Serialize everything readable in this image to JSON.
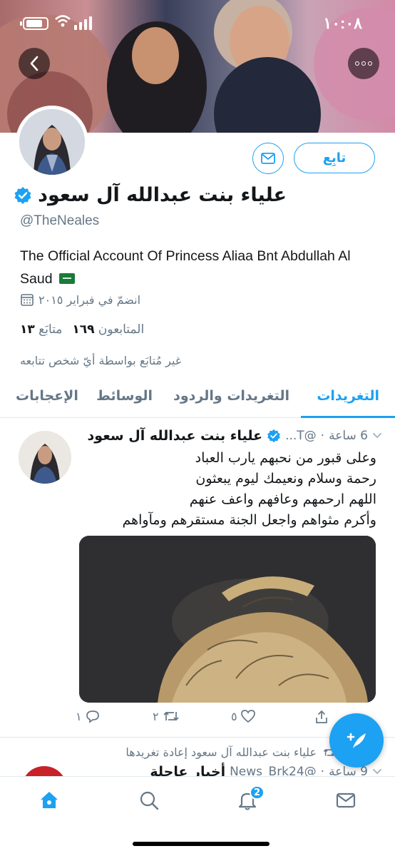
{
  "status_bar": {
    "time": "١٠:٠٨"
  },
  "profile": {
    "display_name": "علياء بنت عبدالله آل سعود",
    "handle": "@TheNeales",
    "bio": "The Official Account Of Princess Aliaa Bnt Abdullah Al Saud",
    "joined": "انضمّ في فبراير ٢٠١٥",
    "following_count": "١٣",
    "following_label": "متابَع",
    "followers_count": "١٦٩",
    "followers_label": "المتابعون",
    "not_followed_note": "غير مُتابَع بواسطة أيّ شخص تتابعه",
    "follow_label": "تابِع"
  },
  "tabs": [
    {
      "label": "التغريدات",
      "active": true
    },
    {
      "label": "التغريدات والردود",
      "active": false
    },
    {
      "label": "الوسائط",
      "active": false
    },
    {
      "label": "الإعجابات",
      "active": false
    }
  ],
  "tweet": {
    "author": "علياء بنت عبدالله آل سعود",
    "handle_trunc": "@T...",
    "time": "6 ساعة",
    "lines": [
      "وعلى قبور من نحبهم يارب العباد",
      "رحمة وسلام ونعيمك ليوم يبعثون",
      "اللهم ارحمهم وعافهم واعف عنهم",
      "وأكرم مثواهم واجعل الجنة مستقرهم ومآواهم"
    ],
    "reply_count": "١",
    "retweet_count": "٢",
    "like_count": "٥"
  },
  "retweet_note": "علياء بنت عبدالله آل سعود إعادة تغريدها",
  "tweet2": {
    "author": "أخبار عاجلة",
    "handle": "@News_Brk24",
    "time": "9 ساعة"
  },
  "tab_bar": {
    "notifications_badge": "2"
  },
  "colors": {
    "accent": "#1da1f2",
    "secondary_text": "#657786",
    "divider": "#e1e8ed"
  }
}
